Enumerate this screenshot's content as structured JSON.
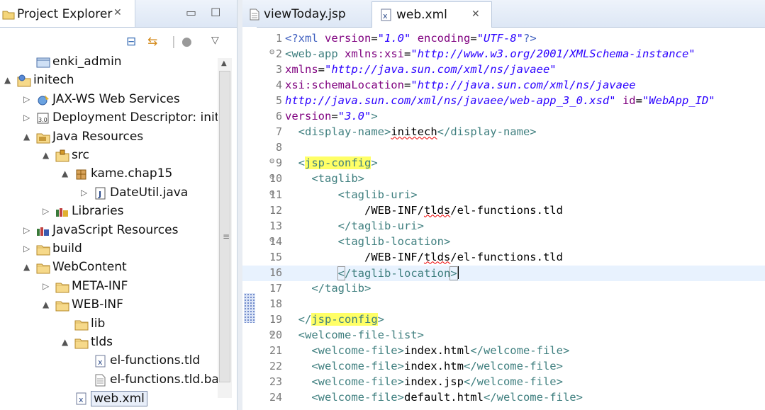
{
  "left_panel": {
    "tab_title": "Project Explorer",
    "tree": [
      {
        "label": "enki_admin",
        "depth": 1,
        "toggle": "",
        "icon": "folder-project-icon"
      },
      {
        "label": "initech",
        "depth": 0,
        "toggle": "▲",
        "icon": "web-project-icon"
      },
      {
        "label": "JAX-WS Web Services",
        "depth": 1,
        "toggle": "▷",
        "icon": "web-services-icon"
      },
      {
        "label": "Deployment Descriptor: inite",
        "depth": 1,
        "toggle": "▷",
        "icon": "deployment-descriptor-icon"
      },
      {
        "label": "Java Resources",
        "depth": 1,
        "toggle": "▲",
        "icon": "java-resources-icon"
      },
      {
        "label": "src",
        "depth": 2,
        "toggle": "▲",
        "icon": "source-folder-icon"
      },
      {
        "label": "kame.chap15",
        "depth": 3,
        "toggle": "▲",
        "icon": "package-icon"
      },
      {
        "label": "DateUtil.java",
        "depth": 4,
        "toggle": "▷",
        "icon": "java-file-icon"
      },
      {
        "label": "Libraries",
        "depth": 2,
        "toggle": "▷",
        "icon": "libraries-icon"
      },
      {
        "label": "JavaScript Resources",
        "depth": 1,
        "toggle": "▷",
        "icon": "javascript-resources-icon"
      },
      {
        "label": "build",
        "depth": 1,
        "toggle": "▷",
        "icon": "folder-icon"
      },
      {
        "label": "WebContent",
        "depth": 1,
        "toggle": "▲",
        "icon": "folder-icon"
      },
      {
        "label": "META-INF",
        "depth": 2,
        "toggle": "▷",
        "icon": "folder-icon"
      },
      {
        "label": "WEB-INF",
        "depth": 2,
        "toggle": "▲",
        "icon": "folder-icon"
      },
      {
        "label": "lib",
        "depth": 3,
        "toggle": "",
        "icon": "folder-icon"
      },
      {
        "label": "tlds",
        "depth": 3,
        "toggle": "▲",
        "icon": "folder-icon"
      },
      {
        "label": "el-functions.tld",
        "depth": 4,
        "toggle": "",
        "icon": "xml-file-icon"
      },
      {
        "label": "el-functions.tld.ba",
        "depth": 4,
        "toggle": "",
        "icon": "text-file-icon"
      },
      {
        "label": "web.xml",
        "depth": 3,
        "toggle": "",
        "icon": "xml-file-icon",
        "selected": true
      }
    ]
  },
  "editor": {
    "tabs": [
      {
        "label": "viewToday.jsp",
        "icon": "jsp-file-icon",
        "active": false
      },
      {
        "label": "web.xml",
        "icon": "xml-file-icon",
        "active": true
      }
    ],
    "lines": [
      {
        "n": "1",
        "fold": "",
        "segs": [
          [
            "pi",
            "<?xml "
          ],
          [
            "attr",
            "version"
          ],
          [
            "txt",
            "="
          ],
          [
            "val",
            "\"1.0\""
          ],
          [
            "txt",
            " "
          ],
          [
            "attr",
            "encoding"
          ],
          [
            "txt",
            "="
          ],
          [
            "val",
            "\"UTF-8\""
          ],
          [
            "pi",
            "?>"
          ]
        ]
      },
      {
        "n": "2",
        "fold": "⊖",
        "segs": [
          [
            "tag",
            "<web-app "
          ],
          [
            "attr",
            "xmlns:xsi"
          ],
          [
            "txt",
            "="
          ],
          [
            "val",
            "\"http://www.w3.org/2001/XMLSchema-instance\""
          ]
        ]
      },
      {
        "n": "3",
        "fold": "",
        "segs": [
          [
            "attr",
            "xmlns"
          ],
          [
            "txt",
            "="
          ],
          [
            "val",
            "\"http://java.sun.com/xml/ns/javaee\""
          ]
        ]
      },
      {
        "n": "4",
        "fold": "",
        "segs": [
          [
            "attr",
            "xsi:schemaLocation"
          ],
          [
            "txt",
            "="
          ],
          [
            "val",
            "\"http://java.sun.com/xml/ns/javaee"
          ]
        ]
      },
      {
        "n": "5",
        "fold": "",
        "segs": [
          [
            "val",
            "http://java.sun.com/xml/ns/javaee/web-app_3_0.xsd\""
          ],
          [
            "txt",
            " "
          ],
          [
            "attr",
            "id"
          ],
          [
            "txt",
            "="
          ],
          [
            "val",
            "\"WebApp_ID\""
          ]
        ]
      },
      {
        "n": "6",
        "fold": "",
        "segs": [
          [
            "attr",
            "version"
          ],
          [
            "txt",
            "="
          ],
          [
            "val",
            "\"3.0\""
          ],
          [
            "tag",
            ">"
          ]
        ]
      },
      {
        "n": "7",
        "fold": "",
        "segs": [
          [
            "txt",
            "  "
          ],
          [
            "tag",
            "<display-name>"
          ],
          [
            "squig",
            "initech"
          ],
          [
            "tag",
            "</display-name>"
          ]
        ]
      },
      {
        "n": "8",
        "fold": "",
        "segs": []
      },
      {
        "n": "9",
        "fold": "⊖",
        "segs": [
          [
            "txt",
            "  "
          ],
          [
            "tag",
            "<"
          ],
          [
            "taghl",
            "jsp-config"
          ],
          [
            "tag",
            ">"
          ]
        ]
      },
      {
        "n": "10",
        "fold": "⊖",
        "segs": [
          [
            "txt",
            "    "
          ],
          [
            "tag",
            "<taglib>"
          ]
        ]
      },
      {
        "n": "11",
        "fold": "⊖",
        "segs": [
          [
            "txt",
            "        "
          ],
          [
            "tag",
            "<taglib-uri>"
          ]
        ]
      },
      {
        "n": "12",
        "fold": "",
        "segs": [
          [
            "txt",
            "            /WEB-INF/"
          ],
          [
            "squig",
            "tlds"
          ],
          [
            "txt",
            "/el-functions.tld"
          ]
        ]
      },
      {
        "n": "13",
        "fold": "",
        "segs": [
          [
            "txt",
            "        "
          ],
          [
            "tag",
            "</taglib-uri>"
          ]
        ]
      },
      {
        "n": "14",
        "fold": "⊖",
        "segs": [
          [
            "txt",
            "        "
          ],
          [
            "tag",
            "<taglib-location>"
          ]
        ]
      },
      {
        "n": "15",
        "fold": "",
        "segs": [
          [
            "txt",
            "            /WEB-INF/"
          ],
          [
            "squig",
            "tlds"
          ],
          [
            "txt",
            "/el-functions.tld"
          ]
        ]
      },
      {
        "n": "16",
        "fold": "",
        "cur": true,
        "segs": [
          [
            "txt",
            "        "
          ],
          [
            "tagbox",
            "<"
          ],
          [
            "tag",
            "/taglib-location"
          ],
          [
            "tagbox",
            ">"
          ],
          [
            "caret",
            ""
          ]
        ]
      },
      {
        "n": "17",
        "fold": "",
        "segs": [
          [
            "txt",
            "    "
          ],
          [
            "tag",
            "</taglib>"
          ]
        ]
      },
      {
        "n": "18",
        "fold": "",
        "segs": []
      },
      {
        "n": "19",
        "fold": "",
        "segs": [
          [
            "txt",
            "  "
          ],
          [
            "tag",
            "</"
          ],
          [
            "taghl",
            "jsp-config"
          ],
          [
            "tag",
            ">"
          ]
        ]
      },
      {
        "n": "20",
        "fold": "⊖",
        "segs": [
          [
            "txt",
            "  "
          ],
          [
            "tag",
            "<welcome-file-list>"
          ]
        ]
      },
      {
        "n": "21",
        "fold": "",
        "segs": [
          [
            "txt",
            "    "
          ],
          [
            "tag",
            "<welcome-file>"
          ],
          [
            "txt",
            "index.html"
          ],
          [
            "tag",
            "</welcome-file>"
          ]
        ]
      },
      {
        "n": "22",
        "fold": "",
        "segs": [
          [
            "txt",
            "    "
          ],
          [
            "tag",
            "<welcome-file>"
          ],
          [
            "txt",
            "index.htm"
          ],
          [
            "tag",
            "</welcome-file>"
          ]
        ]
      },
      {
        "n": "23",
        "fold": "",
        "segs": [
          [
            "txt",
            "    "
          ],
          [
            "tag",
            "<welcome-file>"
          ],
          [
            "txt",
            "index.jsp"
          ],
          [
            "tag",
            "</welcome-file>"
          ]
        ]
      },
      {
        "n": "24",
        "fold": "",
        "segs": [
          [
            "txt",
            "    "
          ],
          [
            "tag",
            "<welcome-file>"
          ],
          [
            "txt",
            "default.html"
          ],
          [
            "tag",
            "</welcome-file>"
          ]
        ]
      }
    ]
  }
}
